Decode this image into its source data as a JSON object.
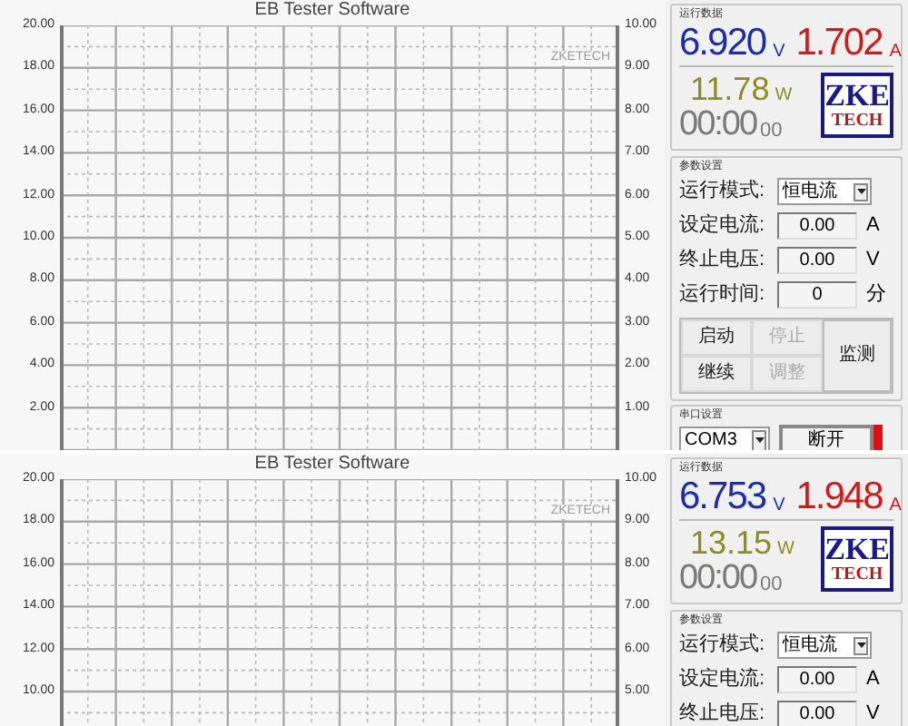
{
  "panels": [
    {
      "chart": {
        "title": "EB Tester Software",
        "watermark": "ZKETECH",
        "left_ticks": [
          "20.00",
          "18.00",
          "16.00",
          "14.00",
          "12.00",
          "10.00",
          "8.00",
          "6.00",
          "4.00",
          "2.00"
        ],
        "right_ticks": [
          "10.00",
          "9.00",
          "8.00",
          "7.00",
          "6.00",
          "5.00",
          "4.00",
          "3.00",
          "2.00",
          "1.00"
        ]
      },
      "side": {
        "readings": {
          "title": "运行数据",
          "voltage": {
            "value": "6.920",
            "unit": "V"
          },
          "current": {
            "value": "1.702",
            "unit": "A"
          },
          "power": {
            "value": "11.78",
            "unit": "W"
          },
          "time": {
            "main": "00:00",
            "small": "00"
          },
          "logo": {
            "top": "ZKE",
            "bottom": "TECH"
          }
        },
        "params": {
          "title": "参数设置",
          "rows": [
            {
              "kind": "select",
              "label": "运行模式:",
              "value": "恒电流"
            },
            {
              "kind": "input",
              "label": "设定电流:",
              "value": "0.00",
              "unit": "A"
            },
            {
              "kind": "input",
              "label": "终止电压:",
              "value": "0.00",
              "unit": "V"
            },
            {
              "kind": "input",
              "label": "运行时间:",
              "value": "0",
              "unit": "分"
            }
          ],
          "buttons": [
            {
              "label": "启动",
              "disabled": false
            },
            {
              "label": "停止",
              "disabled": true
            },
            {
              "label": "继续",
              "disabled": false
            },
            {
              "label": "调整",
              "disabled": true
            }
          ],
          "monitor_button": "监测"
        },
        "port": {
          "title": "串口设置",
          "value": "COM3",
          "button": "断开",
          "indicator": {
            "color": "#dd1111"
          }
        }
      }
    },
    {
      "chart": {
        "title": "EB Tester Software",
        "watermark": "ZKETECH",
        "left_ticks": [
          "20.00",
          "18.00",
          "16.00",
          "14.00",
          "12.00",
          "10.00"
        ],
        "right_ticks": [
          "10.00",
          "9.00",
          "8.00",
          "7.00",
          "6.00",
          "5.00"
        ]
      },
      "side": {
        "readings": {
          "title": "运行数据",
          "voltage": {
            "value": "6.753",
            "unit": "V"
          },
          "current": {
            "value": "1.948",
            "unit": "A"
          },
          "power": {
            "value": "13.15",
            "unit": "W"
          },
          "time": {
            "main": "00:00",
            "small": "00"
          },
          "logo": {
            "top": "ZKE",
            "bottom": "TECH"
          }
        },
        "params": {
          "title": "参数设置",
          "rows": [
            {
              "kind": "select",
              "label": "运行模式:",
              "value": "恒电流"
            },
            {
              "kind": "input",
              "label": "设定电流:",
              "value": "0.00",
              "unit": "A"
            },
            {
              "kind": "input",
              "label": "终止电压:",
              "value": "0.00",
              "unit": "V"
            }
          ]
        }
      }
    }
  ]
}
